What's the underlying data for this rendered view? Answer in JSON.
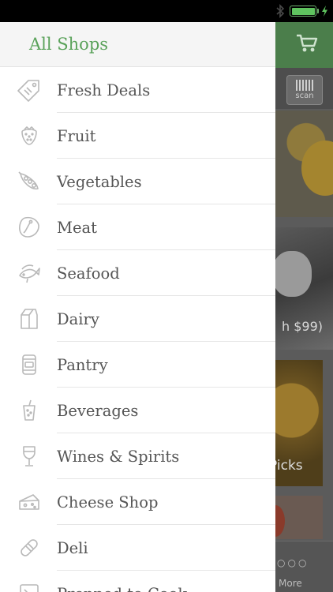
{
  "status_bar": {
    "bluetooth_icon": "bluetooth-icon",
    "battery_icon": "battery-icon",
    "charging_icon": "charging-bolt-icon",
    "battery_level": 1.0,
    "accent": "#5fc45f"
  },
  "drawer": {
    "title": "All Shops",
    "accent": "#5aa25a",
    "items": [
      {
        "label": "Fresh Deals",
        "icon": "price-tag-icon"
      },
      {
        "label": "Fruit",
        "icon": "strawberry-icon"
      },
      {
        "label": "Vegetables",
        "icon": "pea-pod-icon"
      },
      {
        "label": "Meat",
        "icon": "steak-icon"
      },
      {
        "label": "Seafood",
        "icon": "fish-icon"
      },
      {
        "label": "Dairy",
        "icon": "milk-carton-icon"
      },
      {
        "label": "Pantry",
        "icon": "can-icon"
      },
      {
        "label": "Beverages",
        "icon": "drink-cup-icon"
      },
      {
        "label": "Wines & Spirits",
        "icon": "wine-glass-icon"
      },
      {
        "label": "Cheese Shop",
        "icon": "cheese-icon"
      },
      {
        "label": "Deli",
        "icon": "sausage-icon"
      },
      {
        "label": "Prepped to Cook",
        "icon": "prepped-icon"
      }
    ]
  },
  "background_app": {
    "cart_icon": "cart-icon",
    "scan_label": "scan",
    "promo_fragment_1": "h $99)",
    "promo_fragment_2": "Picks",
    "more_label": "More",
    "more_icon": "more-dots-icon"
  }
}
